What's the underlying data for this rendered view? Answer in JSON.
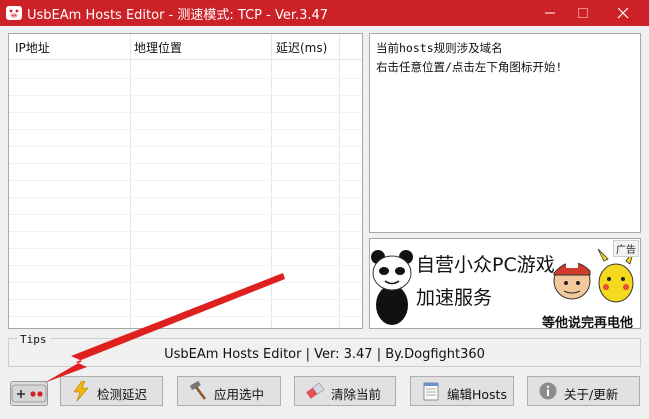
{
  "window": {
    "title": "UsbEAm Hosts Editor - 测速模式: TCP - Ver.3.47",
    "minimize_glyph": "—",
    "close_glyph": "✕"
  },
  "hosts_list": {
    "columns": [
      "IP地址",
      "地理位置",
      "延迟(ms)"
    ],
    "rows": []
  },
  "info": {
    "line1": "当前hosts规则涉及域名",
    "line2": "右击任意位置/点击左下角图标开始!"
  },
  "ad": {
    "tag": "广告",
    "line1": "自营小众PC游戏",
    "line2": "加速服务",
    "caption": "等他说完再电他"
  },
  "tips": {
    "label": "Tips",
    "status": "UsbEAm Hosts Editor | Ver: 3.47 | By.Dogfight360"
  },
  "buttons": {
    "check": "检测延迟",
    "apply": "应用选中",
    "clear": "清除当前",
    "edit": "编辑Hosts",
    "about": "关于/更新"
  },
  "icons": {
    "app": "pig-app-icon",
    "gamepad": "gamepad-icon",
    "check": "lightning-icon",
    "apply": "hammer-icon",
    "clear": "eraser-icon",
    "edit": "notepad-icon",
    "about": "info-icon",
    "annotation": "red-arrow-icon"
  },
  "colors": {
    "titlebar": "#cc2127",
    "arrow": "#e0201f"
  }
}
